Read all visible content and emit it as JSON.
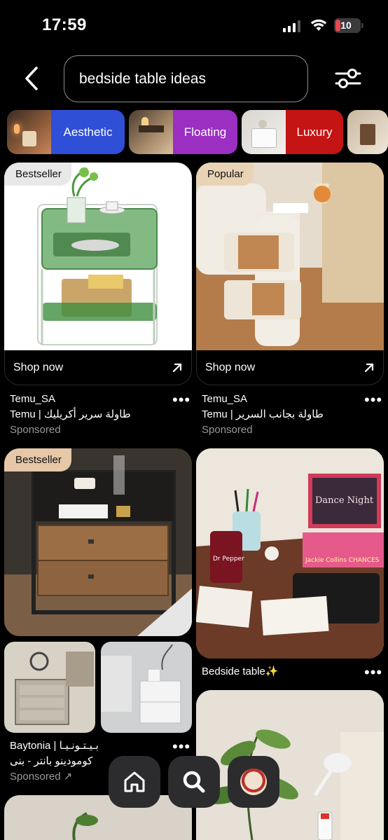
{
  "status_bar": {
    "time": "17:59",
    "battery": "10"
  },
  "search": {
    "query": "bedside table ideas"
  },
  "chips": [
    {
      "label": "Aesthetic",
      "color": "#2f4fd6"
    },
    {
      "label": "Floating",
      "color": "#9b2fc2"
    },
    {
      "label": "Luxury",
      "color": "#c41414"
    }
  ],
  "pins": [
    {
      "badge": "Bestseller",
      "cta": "Shop now",
      "title": "Temu_SA",
      "subtitle": "Temu | طاولة سرير أكريليك",
      "sponsored": "Sponsored"
    },
    {
      "badge": "Popular",
      "cta": "Shop now",
      "title": "Temu_SA",
      "subtitle": "Temu | طاولة بجانب السرير",
      "sponsored": "Sponsored"
    },
    {
      "badge": "Bestseller"
    },
    {
      "title": "Bedside table✨"
    },
    {
      "title": "Baytonia | بـيـتـونـيـا",
      "subtitle": "كومودينو بانتر - بنى",
      "sponsored": "Sponsored"
    }
  ],
  "more_label": "•••",
  "images": {
    "pin3_book_text": "Dance Night",
    "pin3_can_text": "Dr Pepper",
    "pin3_book2_text": "Jackie Collins CHANCES"
  },
  "nav": [
    "home-icon",
    "search-icon",
    "profile-avatar"
  ],
  "colors": {
    "popular_badge": "#e8d3b4",
    "bestseller_badge": "#e8e8e8",
    "bestseller_badge_2": "#e6c8a8"
  }
}
